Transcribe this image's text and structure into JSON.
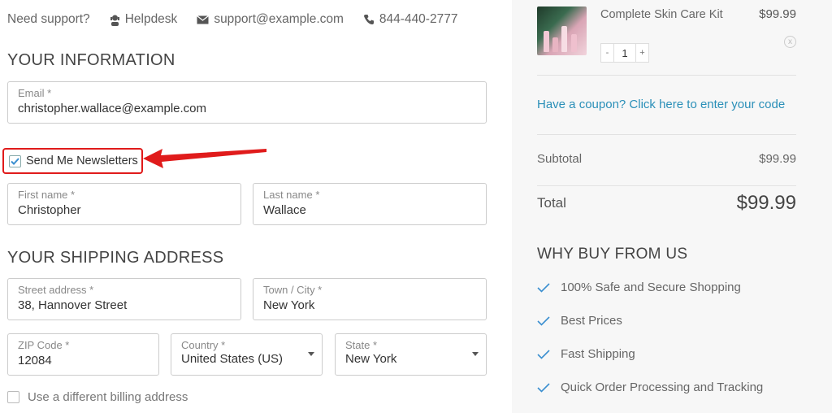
{
  "support": {
    "label": "Need support?",
    "helpdesk": "Helpdesk",
    "email": "support@example.com",
    "phone": "844-440-2777"
  },
  "your_information": {
    "title": "YOUR INFORMATION",
    "email": {
      "label": "Email *",
      "value": "christopher.wallace@example.com"
    },
    "newsletter": {
      "label": "Send Me Newsletters",
      "checked": true
    },
    "first_name": {
      "label": "First name *",
      "value": "Christopher"
    },
    "last_name": {
      "label": "Last name *",
      "value": "Wallace"
    }
  },
  "shipping": {
    "title": "YOUR SHIPPING ADDRESS",
    "street": {
      "label": "Street address *",
      "value": "38, Hannover Street"
    },
    "city": {
      "label": "Town / City *",
      "value": "New York"
    },
    "zip": {
      "label": "ZIP Code *",
      "value": "12084"
    },
    "country": {
      "label": "Country *",
      "value": "United States (US)"
    },
    "state": {
      "label": "State *",
      "value": "New York"
    },
    "billing_label": "Use a different billing address"
  },
  "order": {
    "product_name": "Complete Skin Care Kit",
    "product_price": "$99.99",
    "quantity": "1",
    "qty_minus": "-",
    "qty_plus": "+",
    "remove": "x",
    "coupon_text": "Have a coupon? Click here to enter your code",
    "subtotal_label": "Subtotal",
    "subtotal_value": "$99.99",
    "total_label": "Total",
    "total_value": "$99.99"
  },
  "why": {
    "title": "WHY BUY FROM US",
    "items": [
      "100% Safe and Secure Shopping",
      "Best Prices",
      "Fast Shipping",
      "Quick Order Processing and Tracking"
    ]
  },
  "colors": {
    "annotation_red": "#e01b1b",
    "link_blue": "#2a8fb8",
    "check_blue": "#3b8fd0",
    "sidebar_bg": "#f7f7f7"
  },
  "icons": [
    "helpdesk-icon",
    "envelope-icon",
    "phone-icon",
    "check-icon",
    "remove-icon",
    "dropdown-caret-icon"
  ]
}
